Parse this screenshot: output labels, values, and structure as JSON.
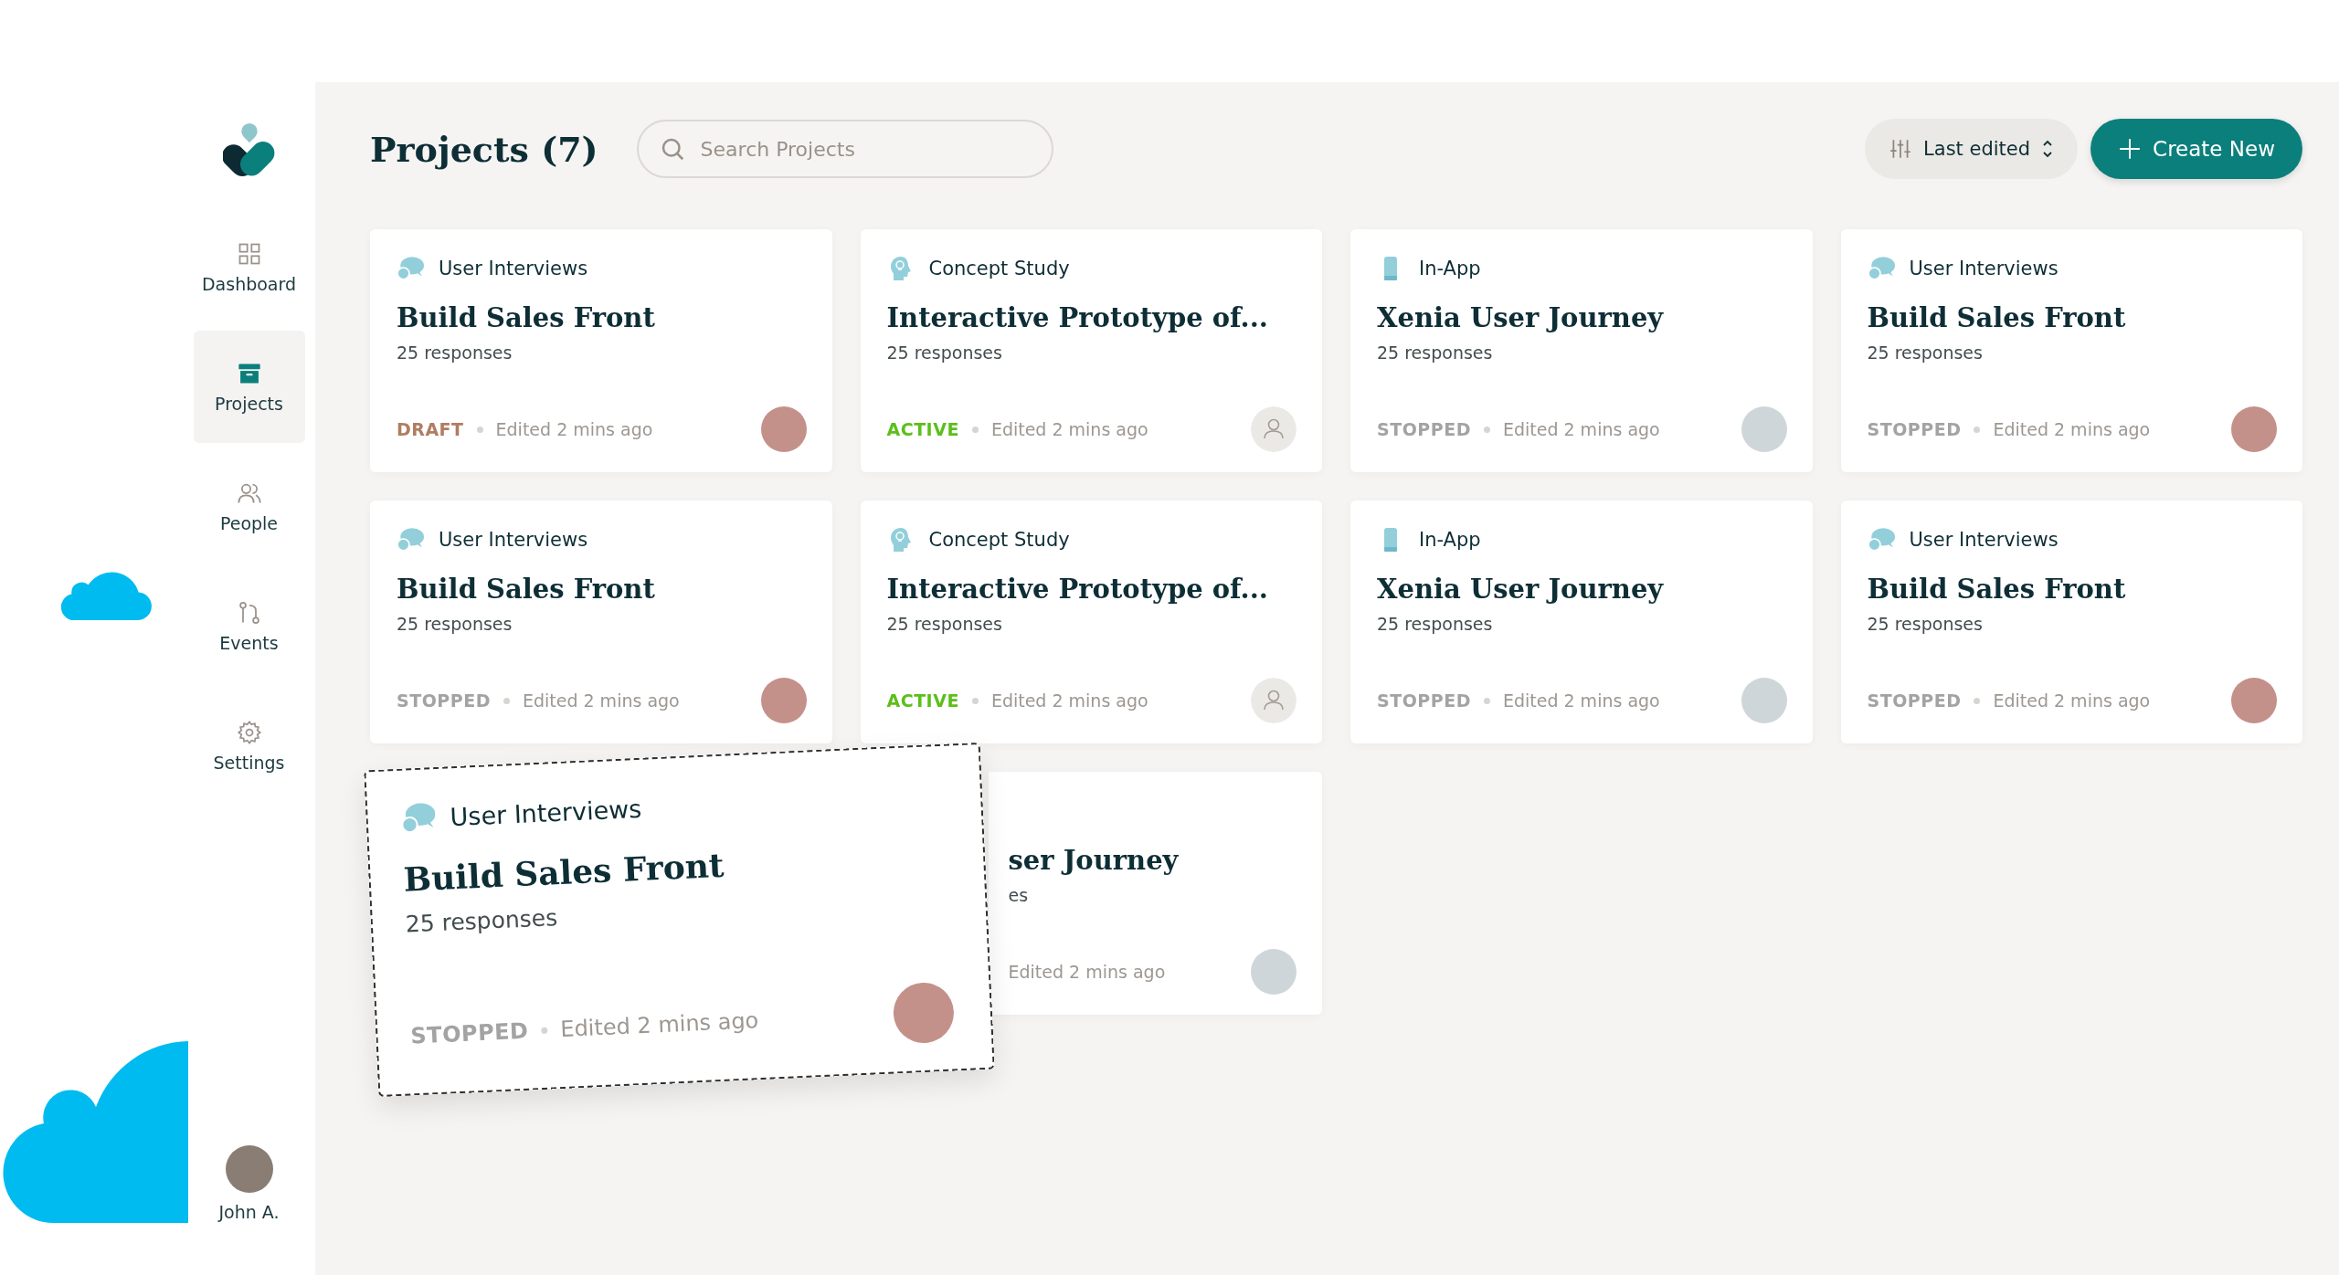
{
  "sidebar": {
    "items": [
      {
        "label": "Dashboard",
        "kind": "dashboard",
        "selected": false
      },
      {
        "label": "Projects",
        "kind": "projects",
        "selected": true
      },
      {
        "label": "People",
        "kind": "people",
        "selected": false
      },
      {
        "label": "Events",
        "kind": "events",
        "selected": false
      },
      {
        "label": "Settings",
        "kind": "settings",
        "selected": false
      }
    ],
    "user": {
      "name": "John A."
    }
  },
  "header": {
    "title": "Projects (7)",
    "search": {
      "placeholder": "Search Projects"
    },
    "sort": {
      "label": "Last edited"
    },
    "create_button": {
      "label": "Create New"
    }
  },
  "cards": [
    {
      "type": {
        "label": "User Interviews",
        "kind": "interviews"
      },
      "title": "Build Sales Front",
      "responses": "25 responses",
      "status": {
        "label": "DRAFT",
        "kind": "draft"
      },
      "edited": "Edited 2 mins ago",
      "avatar": {
        "kind": "woman"
      }
    },
    {
      "type": {
        "label": "Concept Study",
        "kind": "concept"
      },
      "title": "Interactive Prototype of...",
      "responses": "25 responses",
      "status": {
        "label": "ACTIVE",
        "kind": "active"
      },
      "edited": "Edited 2 mins ago",
      "avatar": {
        "kind": "empty"
      }
    },
    {
      "type": {
        "label": "In-App",
        "kind": "in-app"
      },
      "title": "Xenia User Journey",
      "responses": "25 responses",
      "status": {
        "label": "STOPPED",
        "kind": "stopped"
      },
      "edited": "Edited 2 mins ago",
      "avatar": {
        "kind": "man"
      }
    },
    {
      "type": {
        "label": "User Interviews",
        "kind": "interviews"
      },
      "title": "Build Sales Front",
      "responses": "25 responses",
      "status": {
        "label": "STOPPED",
        "kind": "stopped"
      },
      "edited": "Edited 2 mins ago",
      "avatar": {
        "kind": "woman"
      }
    },
    {
      "type": {
        "label": "User Interviews",
        "kind": "interviews"
      },
      "title": "Build Sales Front",
      "responses": "25 responses",
      "status": {
        "label": "STOPPED",
        "kind": "stopped"
      },
      "edited": "Edited 2 mins ago",
      "avatar": {
        "kind": "woman"
      }
    },
    {
      "type": {
        "label": "Concept Study",
        "kind": "concept"
      },
      "title": "Interactive Prototype of...",
      "responses": "25 responses",
      "status": {
        "label": "ACTIVE",
        "kind": "active"
      },
      "edited": "Edited 2 mins ago",
      "avatar": {
        "kind": "empty"
      }
    },
    {
      "type": {
        "label": "In-App",
        "kind": "in-app"
      },
      "title": "Xenia User Journey",
      "responses": "25 responses",
      "status": {
        "label": "STOPPED",
        "kind": "stopped"
      },
      "edited": "Edited 2 mins ago",
      "avatar": {
        "kind": "man"
      }
    },
    {
      "type": {
        "label": "User Interviews",
        "kind": "interviews"
      },
      "title": "Build Sales Front",
      "responses": "25 responses",
      "status": {
        "label": "STOPPED",
        "kind": "stopped"
      },
      "edited": "Edited 2 mins ago",
      "avatar": {
        "kind": "woman"
      }
    }
  ],
  "covered_card": {
    "title": "ser Journey",
    "responses": "es",
    "edited": "Edited 2 mins ago",
    "avatar": {
      "kind": "man"
    }
  },
  "dragged_card": {
    "type": {
      "label": "User Interviews",
      "kind": "interviews"
    },
    "title": "Build Sales Front",
    "responses": "25 responses",
    "status": {
      "label": "STOPPED",
      "kind": "stopped"
    },
    "edited": "Edited 2 mins ago",
    "avatar": {
      "kind": "woman"
    }
  }
}
